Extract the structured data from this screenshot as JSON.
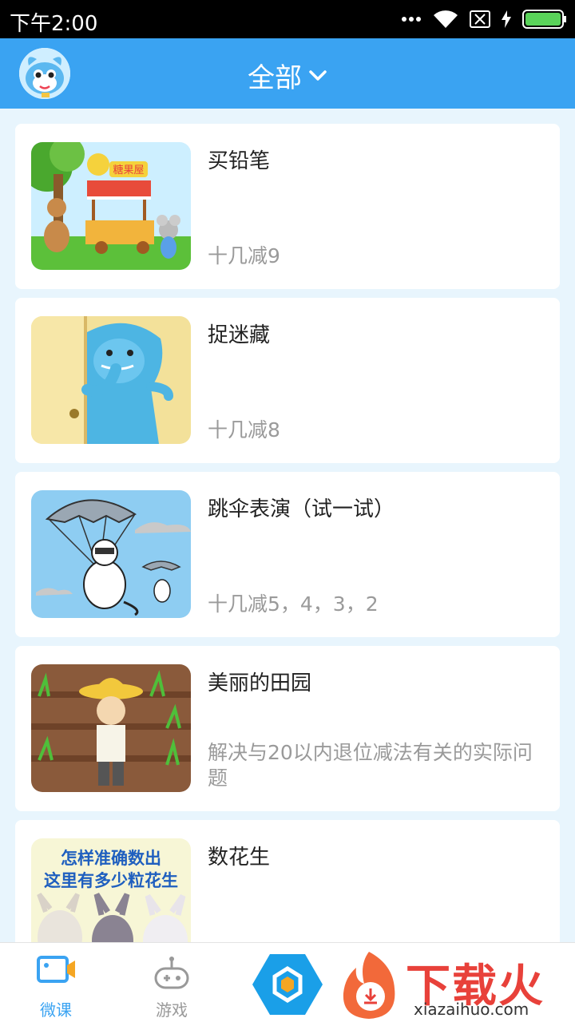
{
  "status": {
    "time": "下午2:00"
  },
  "header": {
    "title": "全部"
  },
  "lessons": [
    {
      "title": "买铅笔",
      "subtitle": "十几减9",
      "thumb_text": "糖果屋"
    },
    {
      "title": "捉迷藏",
      "subtitle": "十几减8"
    },
    {
      "title": "跳伞表演（试一试）",
      "subtitle": "十几减5，4，3，2"
    },
    {
      "title": "美丽的田园",
      "subtitle": "解决与20以内退位减法有关的实际问题"
    },
    {
      "title": "数花生",
      "subtitle": "",
      "thumb_text_line1": "怎样准确数出",
      "thumb_text_line2": "这里有多少粒花生"
    }
  ],
  "tabs": [
    {
      "label": "微课",
      "icon": "video-icon",
      "color": "#3aa3f2"
    },
    {
      "label": "游戏",
      "icon": "gamepad-icon",
      "color": "#999999"
    }
  ],
  "watermark": {
    "text": "下载火",
    "url_text": "xiazaihuo.com"
  },
  "colors": {
    "accent": "#3aa3f2",
    "background": "#e8f5fd"
  }
}
